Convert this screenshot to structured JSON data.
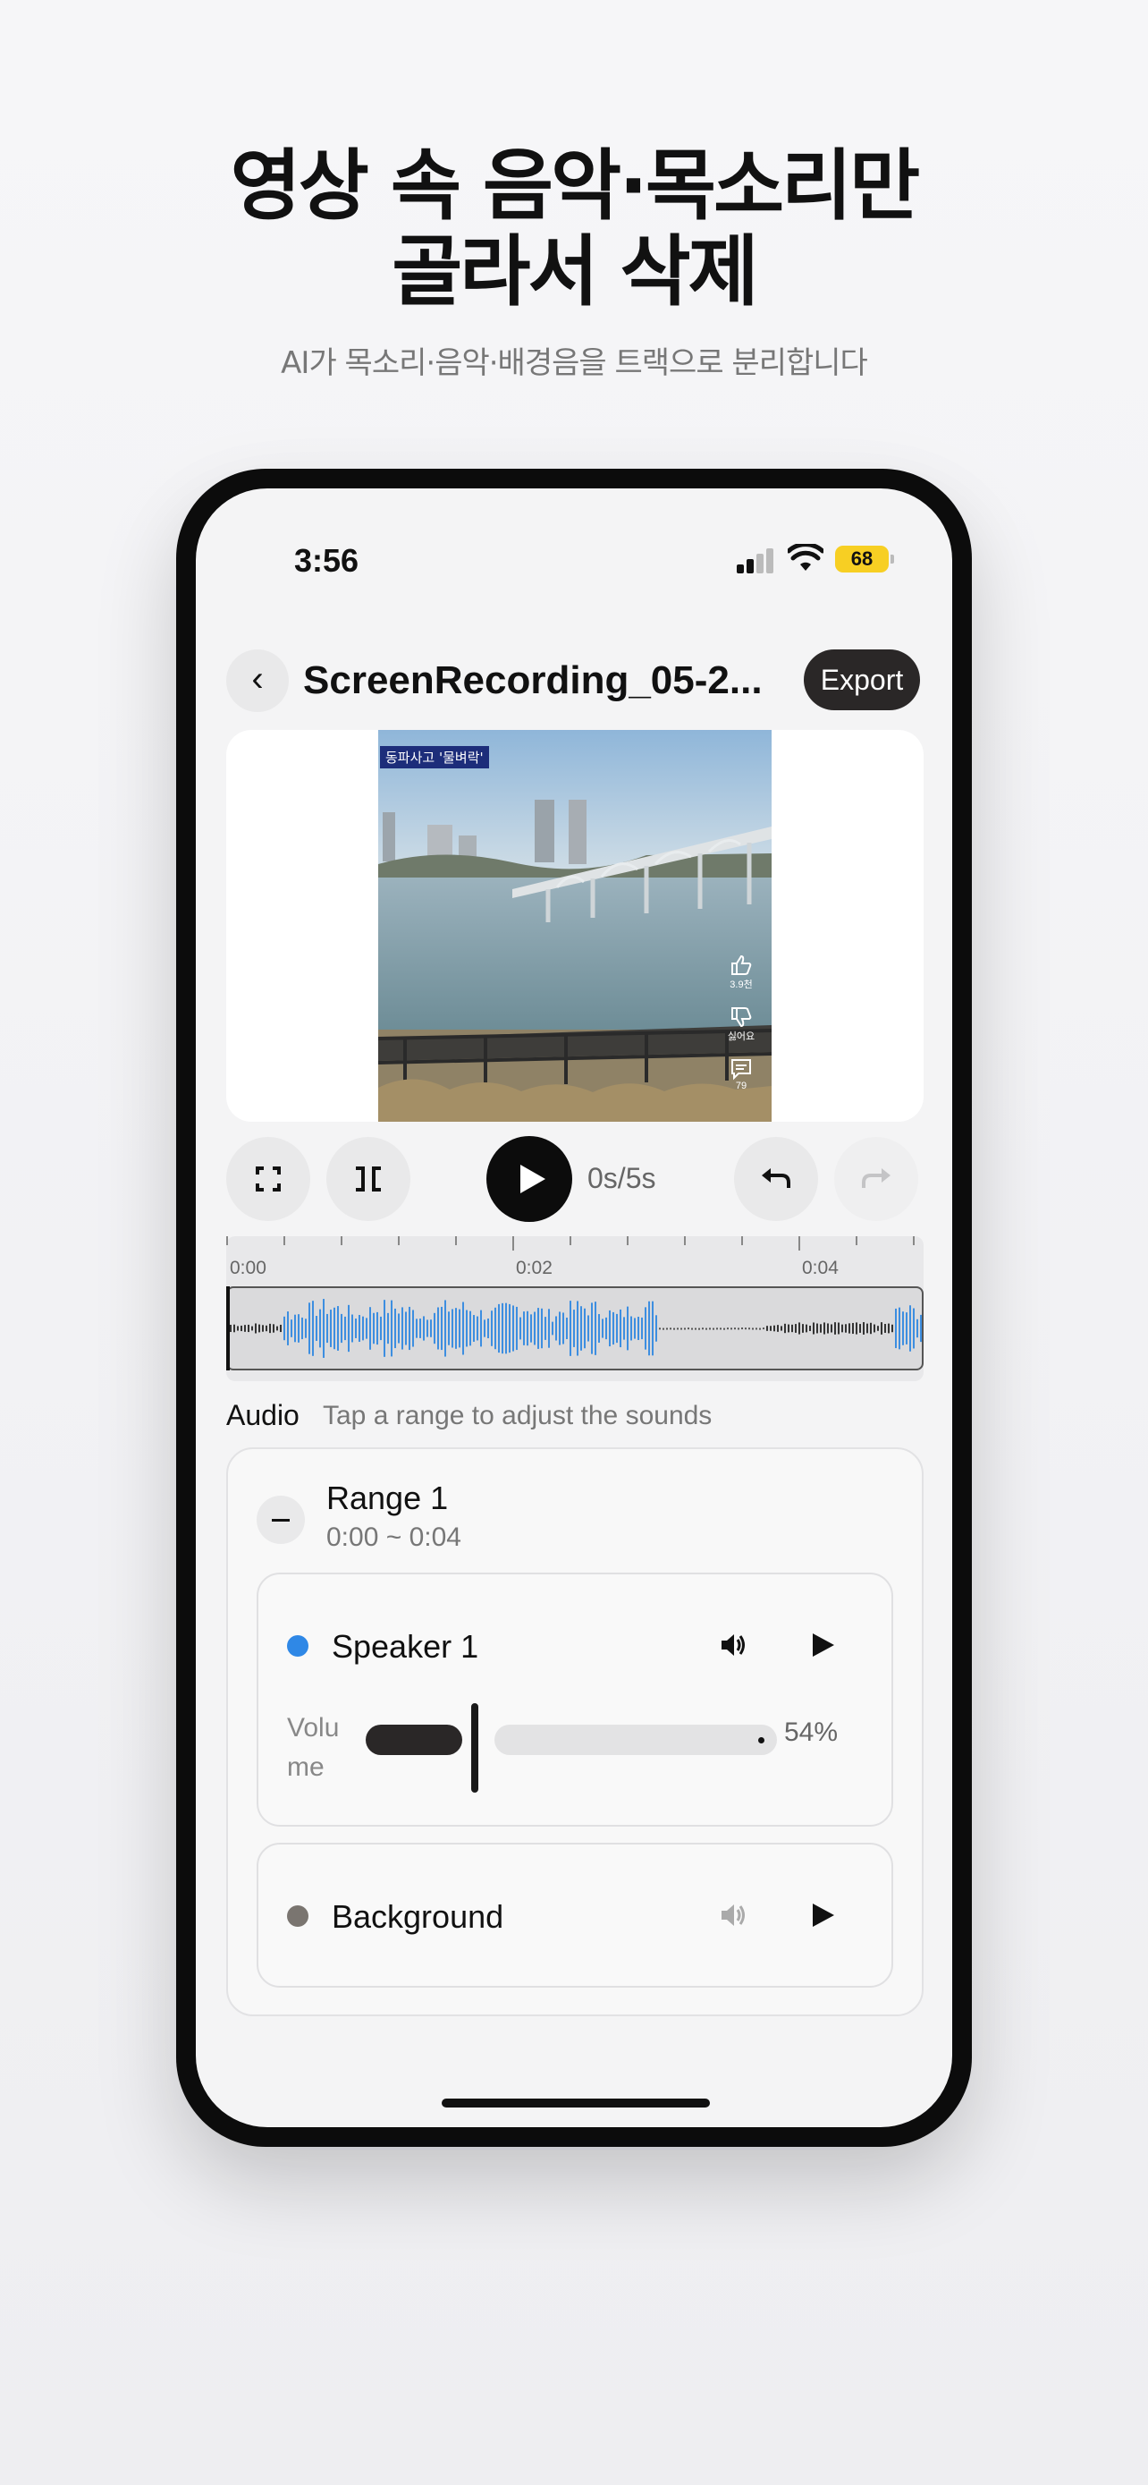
{
  "marketing": {
    "headline_line1": "영상 속 음악·목소리만",
    "headline_line2": "골라서 삭제",
    "subheadline": "AI가 목소리·음악·배경음을 트랙으로 분리합니다"
  },
  "status_bar": {
    "time": "3:56",
    "battery": "68",
    "battery_color": "#f7cf23"
  },
  "header": {
    "back_icon": "‹",
    "title": "ScreenRecording_05-2...",
    "export_label": "Export"
  },
  "video": {
    "badge": "동파사고 '물벼락'",
    "likes": "3.9천",
    "dislike_label": "싫어요",
    "comments": "79"
  },
  "playback": {
    "time_readout": "0s/5s"
  },
  "timeline": {
    "tick_labels": [
      "0:00",
      "0:02",
      "0:04"
    ]
  },
  "audio": {
    "label": "Audio",
    "hint": "Tap a range to adjust the sounds"
  },
  "range": {
    "title": "Range 1",
    "time": "0:00 ~ 0:04"
  },
  "tracks": {
    "speaker": {
      "name": "Speaker 1",
      "dot_color": "#2f88e6",
      "volume_label": "Volu\nme",
      "volume_percent": "54%",
      "volume_level": 0.54
    },
    "background": {
      "name": "Background",
      "dot_color": "#7a7570"
    }
  },
  "colors": {
    "waveform": "#3d8ee0",
    "export_bg": "#2a2727"
  }
}
